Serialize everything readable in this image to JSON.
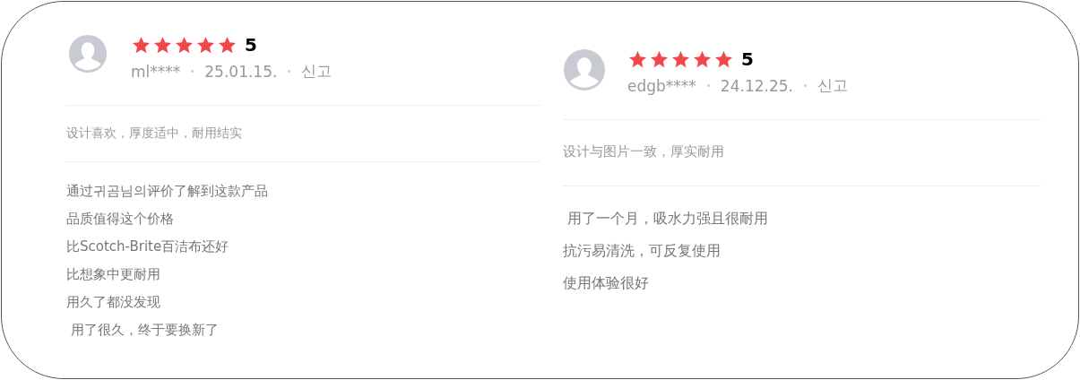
{
  "reviews": [
    {
      "user": "ml****",
      "stars": 5,
      "rating": "5",
      "date": "25.01.15.",
      "report": "신고",
      "summary": "设计喜欢，厚度适中，耐用结实",
      "lines": [
        "通过귀곰님의评价了解到这款产品",
        "品质值得这个价格",
        "比Scotch-Brite百洁布还好",
        "比想象中更耐用",
        "用久了都没发现",
        " 用了很久，终于要换新了"
      ]
    },
    {
      "user": "edgb****",
      "stars": 5,
      "rating": "5",
      "date": "24.12.25.",
      "report": "신고",
      "summary": "设计与图片一致，厚实耐用",
      "lines": [
        " 用了一个月，吸水力强且很耐用",
        "抗污易清洗，可反复使用",
        "使用体验很好"
      ]
    }
  ]
}
